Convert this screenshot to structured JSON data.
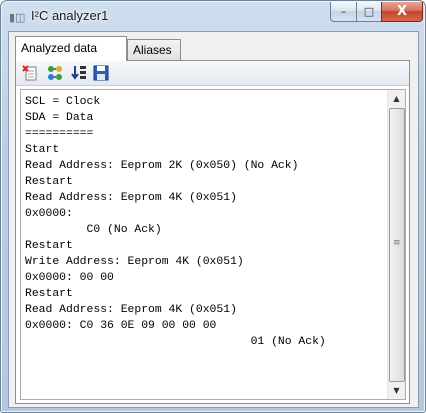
{
  "window": {
    "title": "I²C analyzer1",
    "buttons": {
      "minimize": "–",
      "maximize": "□",
      "close": "X"
    }
  },
  "tabs": [
    {
      "label": "Analyzed data",
      "active": true
    },
    {
      "label": "Aliases",
      "active": false
    }
  ],
  "toolbar": {
    "icons": [
      "clear-log-icon",
      "swap-icon",
      "sort-icon",
      "save-icon"
    ]
  },
  "log_lines": [
    "SCL = Clock",
    "SDA = Data",
    "==========",
    "Start",
    "Read Address: Eeprom 2K (0x050) (No Ack)",
    "Restart",
    "Read Address: Eeprom 4K (0x051)",
    "0x0000:",
    "         C0 (No Ack)",
    "Restart",
    "Write Address: Eeprom 4K (0x051)",
    "0x0000: 00 00",
    "Restart",
    "Read Address: Eeprom 4K (0x051)",
    "0x0000: C0 36 0E 09 00 00 00",
    "                                 01 (No Ack)"
  ],
  "scrollbar": {
    "up": "▲",
    "down": "▼",
    "grip": "≡"
  }
}
